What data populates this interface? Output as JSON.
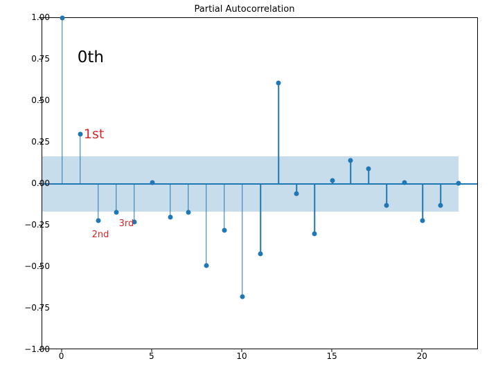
{
  "chart_data": {
    "type": "stem",
    "title": "Partial Autocorrelation",
    "xlabel": "",
    "ylabel": "",
    "x": [
      0,
      1,
      2,
      3,
      4,
      5,
      6,
      7,
      8,
      9,
      10,
      11,
      12,
      13,
      14,
      15,
      16,
      17,
      18,
      19,
      20,
      21,
      22
    ],
    "values": [
      1.0,
      0.3,
      -0.22,
      -0.17,
      -0.23,
      0.01,
      -0.2,
      -0.17,
      -0.49,
      -0.28,
      -0.68,
      -0.42,
      0.61,
      -0.06,
      -0.3,
      0.02,
      0.14,
      0.09,
      -0.13,
      0.01,
      -0.22,
      -0.13,
      0.005
    ],
    "xlim": [
      -1.1,
      23.1
    ],
    "ylim": [
      -1.0,
      1.0
    ],
    "xticks": [
      0,
      5,
      10,
      15,
      20
    ],
    "yticks": [
      -1.0,
      -0.75,
      -0.5,
      -0.25,
      0.0,
      0.25,
      0.5,
      0.75,
      1.0
    ],
    "ytick_labels": [
      "−1.00",
      "−0.75",
      "−0.50",
      "−0.25",
      "0.00",
      "0.25",
      "0.50",
      "0.75",
      "1.00"
    ],
    "confidence_band": {
      "low": -0.165,
      "high": 0.165,
      "x_start": -1.1,
      "x_end": 22.0
    },
    "series_color": "#1f77b4",
    "annotations": [
      {
        "text": "0th",
        "x": 0.85,
        "y": 0.77,
        "color": "#000000",
        "font_size": 23
      },
      {
        "text": "1st",
        "x": 1.2,
        "y": 0.305,
        "color": "#d62728",
        "font_size": 19
      },
      {
        "text": "2nd",
        "x": 1.65,
        "y": -0.3,
        "color": "#d62728",
        "font_size": 13
      },
      {
        "text": "3rd",
        "x": 3.15,
        "y": -0.235,
        "color": "#d62728",
        "font_size": 13
      }
    ]
  }
}
